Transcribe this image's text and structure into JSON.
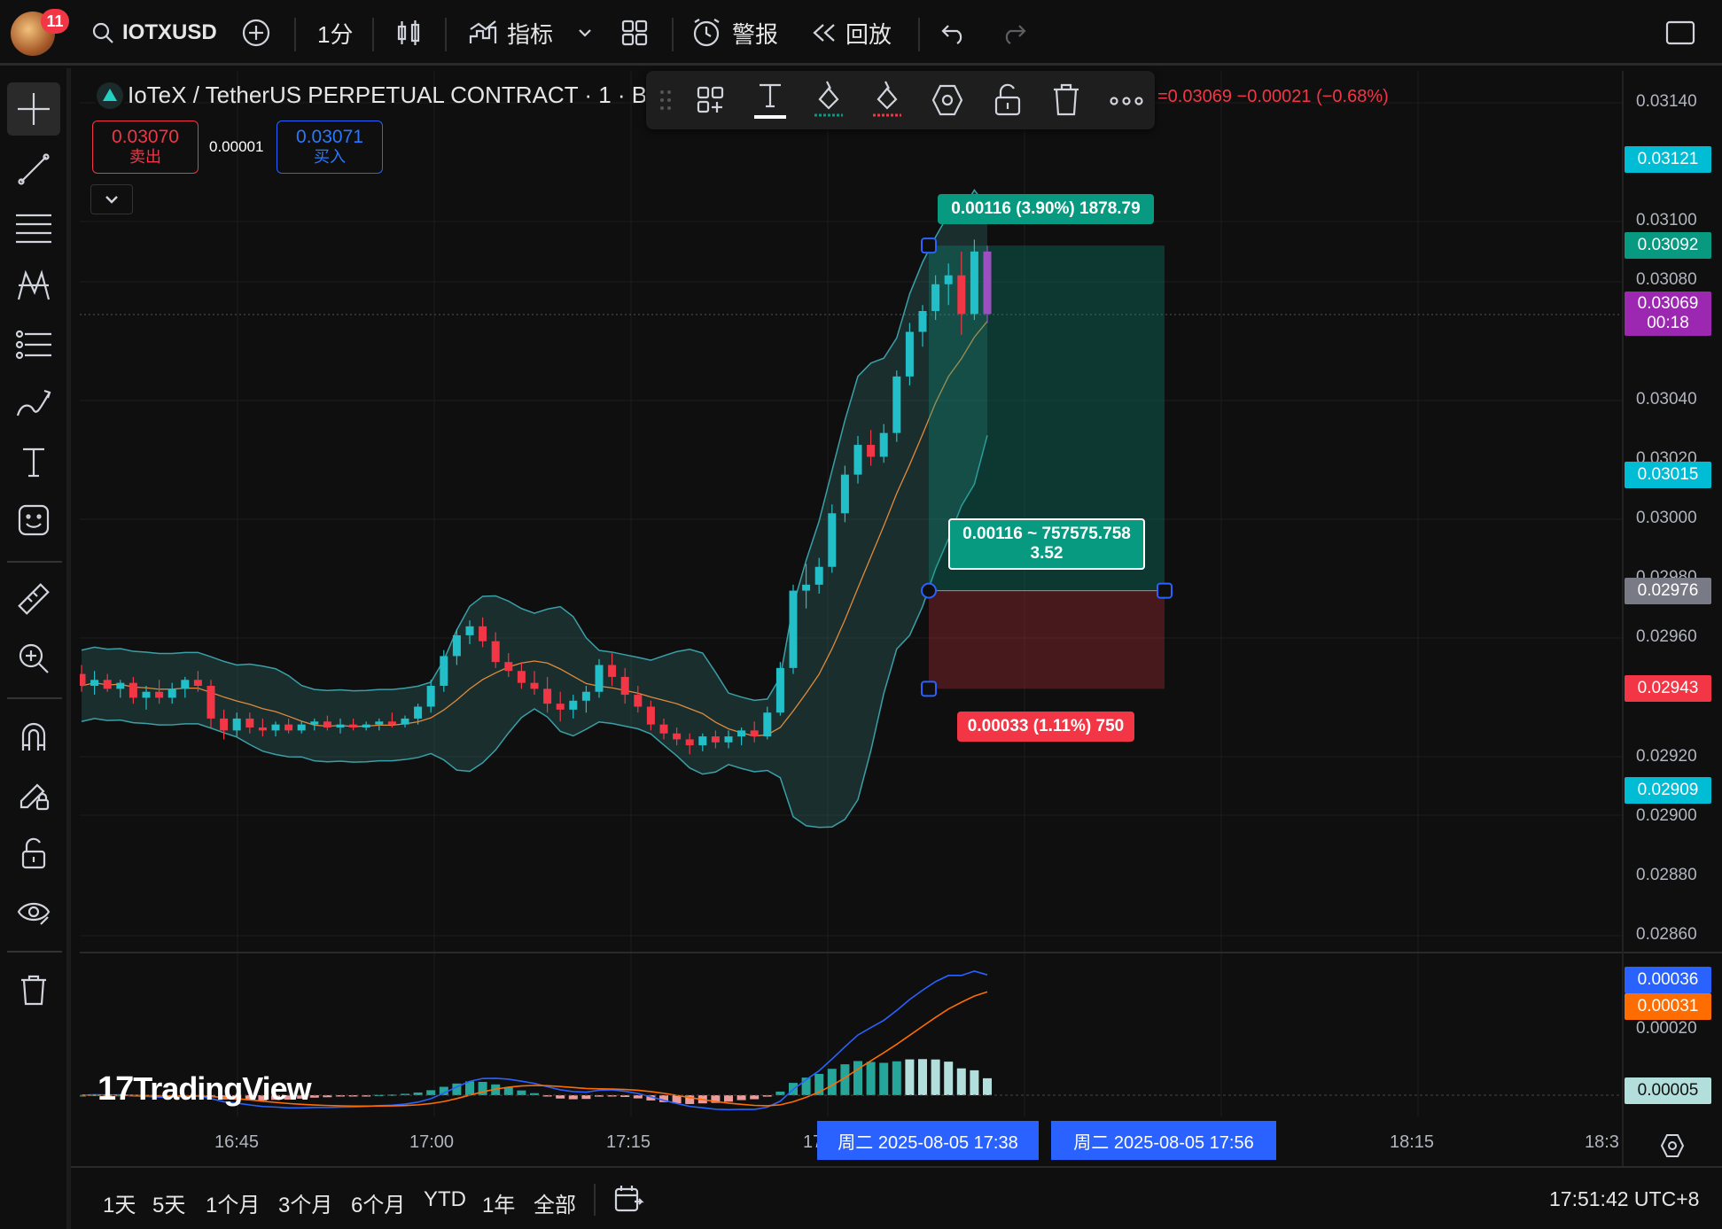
{
  "header": {
    "notification_count": "11",
    "symbol": "IOTXUSD",
    "interval": "1分",
    "indicators_label": "指标",
    "alerts_label": "警报",
    "replay_label": "回放"
  },
  "legend": {
    "title": "IoTeX / TetherUS PERPETUAL CONTRACT · 1 · BI",
    "ohlc_change": "=0.03069  −0.00021 (−0.68%)",
    "sell_price": "0.03070",
    "sell_label": "卖出",
    "spread": "0.00001",
    "buy_price": "0.03071",
    "buy_label": "买入"
  },
  "price_axis": {
    "ticks": [
      "0.03140",
      "0.03100",
      "0.03080",
      "0.03040",
      "0.03020",
      "0.03000",
      "0.02980",
      "0.02960",
      "0.02940",
      "0.02920",
      "0.02900",
      "0.02880",
      "0.02860"
    ],
    "tags": [
      {
        "text": "0.03121",
        "color": "#00bcd4"
      },
      {
        "text": "0.03092",
        "color": "#089981"
      },
      {
        "text": "0.03069",
        "sub": "00:18",
        "color": "#9c27b0"
      },
      {
        "text": "0.03015",
        "color": "#00bcd4"
      },
      {
        "text": "0.02976",
        "color": "#787b86"
      },
      {
        "text": "0.02943",
        "color": "#f23645"
      },
      {
        "text": "0.02909",
        "color": "#00bcd4"
      }
    ]
  },
  "macd_axis": {
    "ticks": [
      "0.00020",
      "0.00000"
    ],
    "tags": [
      {
        "text": "0.00036",
        "color": "#2962ff"
      },
      {
        "text": "0.00031",
        "color": "#ff6d00"
      },
      {
        "text": "0.00005",
        "color": "#b2dfdb"
      }
    ]
  },
  "position": {
    "target_label": "0.00116 (3.90%) 1878.79",
    "center_line1": "0.00116 ~ 757575.758",
    "center_line2": "3.52",
    "stop_label": "0.00033 (1.11%) 750"
  },
  "time_axis": {
    "ticks": [
      "16:45",
      "17:00",
      "17:15",
      "17",
      "18:15",
      "18:3"
    ],
    "cursor_start": "周二 2025-08-05   17:38",
    "cursor_end": "周二 2025-08-05   17:56"
  },
  "watermark": "TradingView",
  "bottom_bar": {
    "ranges": [
      "1天",
      "5天",
      "1个月",
      "3个月",
      "6个月",
      "YTD",
      "1年",
      "全部"
    ],
    "clock": "17:51:42 UTC+8"
  },
  "chart_data": {
    "type": "candlestick",
    "title": "IoTeX / TetherUS PERPETUAL CONTRACT · 1 · BI",
    "candles": [
      [
        0.02948,
        0.02951,
        0.02942,
        0.02944
      ],
      [
        0.02944,
        0.02949,
        0.02941,
        0.02946
      ],
      [
        0.02946,
        0.02948,
        0.02942,
        0.02943
      ],
      [
        0.02943,
        0.02946,
        0.0294,
        0.02945
      ],
      [
        0.02945,
        0.02947,
        0.02938,
        0.0294
      ],
      [
        0.0294,
        0.02944,
        0.02936,
        0.02942
      ],
      [
        0.02942,
        0.02946,
        0.02938,
        0.0294
      ],
      [
        0.0294,
        0.02945,
        0.02938,
        0.02943
      ],
      [
        0.02943,
        0.02947,
        0.0294,
        0.02946
      ],
      [
        0.02946,
        0.02949,
        0.02942,
        0.02944
      ],
      [
        0.02944,
        0.02946,
        0.0293,
        0.02933
      ],
      [
        0.02933,
        0.02936,
        0.02926,
        0.02929
      ],
      [
        0.02929,
        0.02935,
        0.02927,
        0.02933
      ],
      [
        0.02933,
        0.02935,
        0.02928,
        0.0293
      ],
      [
        0.0293,
        0.02933,
        0.02927,
        0.02929
      ],
      [
        0.02929,
        0.02932,
        0.02927,
        0.02931
      ],
      [
        0.02931,
        0.02933,
        0.02928,
        0.02929
      ],
      [
        0.02929,
        0.02932,
        0.02928,
        0.02931
      ],
      [
        0.02931,
        0.02933,
        0.02929,
        0.02932
      ],
      [
        0.02932,
        0.02934,
        0.02929,
        0.0293
      ],
      [
        0.0293,
        0.02933,
        0.02928,
        0.02931
      ],
      [
        0.02931,
        0.02933,
        0.02929,
        0.0293
      ],
      [
        0.0293,
        0.02932,
        0.02929,
        0.02931
      ],
      [
        0.02931,
        0.02933,
        0.02929,
        0.02932
      ],
      [
        0.02932,
        0.02935,
        0.0293,
        0.02931
      ],
      [
        0.02931,
        0.02934,
        0.0293,
        0.02933
      ],
      [
        0.02933,
        0.02938,
        0.02931,
        0.02937
      ],
      [
        0.02937,
        0.02946,
        0.02935,
        0.02944
      ],
      [
        0.02944,
        0.02956,
        0.02942,
        0.02954
      ],
      [
        0.02954,
        0.02963,
        0.02951,
        0.02961
      ],
      [
        0.02961,
        0.02966,
        0.02958,
        0.02964
      ],
      [
        0.02964,
        0.02967,
        0.02957,
        0.02959
      ],
      [
        0.02959,
        0.02962,
        0.0295,
        0.02952
      ],
      [
        0.02952,
        0.02955,
        0.02947,
        0.02949
      ],
      [
        0.02949,
        0.02952,
        0.02943,
        0.02945
      ],
      [
        0.02945,
        0.02949,
        0.02941,
        0.02943
      ],
      [
        0.02943,
        0.02947,
        0.02935,
        0.02938
      ],
      [
        0.02938,
        0.02942,
        0.02932,
        0.02936
      ],
      [
        0.02936,
        0.02941,
        0.02933,
        0.02939
      ],
      [
        0.02939,
        0.02944,
        0.02935,
        0.02942
      ],
      [
        0.02942,
        0.02953,
        0.0294,
        0.02951
      ],
      [
        0.02951,
        0.02955,
        0.02944,
        0.02947
      ],
      [
        0.02947,
        0.0295,
        0.02938,
        0.02941
      ],
      [
        0.02941,
        0.02944,
        0.02935,
        0.02937
      ],
      [
        0.02937,
        0.02939,
        0.02929,
        0.02931
      ],
      [
        0.02931,
        0.02933,
        0.02926,
        0.02928
      ],
      [
        0.02928,
        0.0293,
        0.02924,
        0.02926
      ],
      [
        0.02926,
        0.02928,
        0.02921,
        0.02924
      ],
      [
        0.02924,
        0.02928,
        0.02922,
        0.02927
      ],
      [
        0.02927,
        0.02929,
        0.02923,
        0.02925
      ],
      [
        0.02925,
        0.02929,
        0.02923,
        0.02927
      ],
      [
        0.02927,
        0.0293,
        0.02924,
        0.02929
      ],
      [
        0.02929,
        0.02932,
        0.02925,
        0.02927
      ],
      [
        0.02927,
        0.02937,
        0.02926,
        0.02935
      ],
      [
        0.02935,
        0.02952,
        0.02934,
        0.0295
      ],
      [
        0.0295,
        0.02978,
        0.02948,
        0.02976
      ],
      [
        0.02976,
        0.02985,
        0.0297,
        0.02978
      ],
      [
        0.02978,
        0.02987,
        0.02975,
        0.02984
      ],
      [
        0.02984,
        0.03005,
        0.02982,
        0.03002
      ],
      [
        0.03002,
        0.03018,
        0.02999,
        0.03015
      ],
      [
        0.03015,
        0.03028,
        0.03012,
        0.03025
      ],
      [
        0.03025,
        0.0303,
        0.03018,
        0.03021
      ],
      [
        0.03021,
        0.03032,
        0.03019,
        0.03029
      ],
      [
        0.03029,
        0.0305,
        0.03026,
        0.03048
      ],
      [
        0.03048,
        0.03066,
        0.03045,
        0.03063
      ],
      [
        0.03063,
        0.03072,
        0.03058,
        0.0307
      ],
      [
        0.0307,
        0.03082,
        0.03067,
        0.03079
      ],
      [
        0.03079,
        0.03086,
        0.03072,
        0.03082
      ],
      [
        0.03082,
        0.0309,
        0.03062,
        0.03069
      ],
      [
        0.03069,
        0.03094,
        0.03067,
        0.0309
      ],
      [
        0.0309,
        0.03092,
        0.03066,
        0.03069
      ]
    ],
    "position_tool": {
      "entry": 0.02976,
      "target": 0.03092,
      "stop": 0.02943
    },
    "macd": {
      "macd_last": 0.00036,
      "signal_last": 0.00031,
      "hist_last": 5e-05
    }
  }
}
